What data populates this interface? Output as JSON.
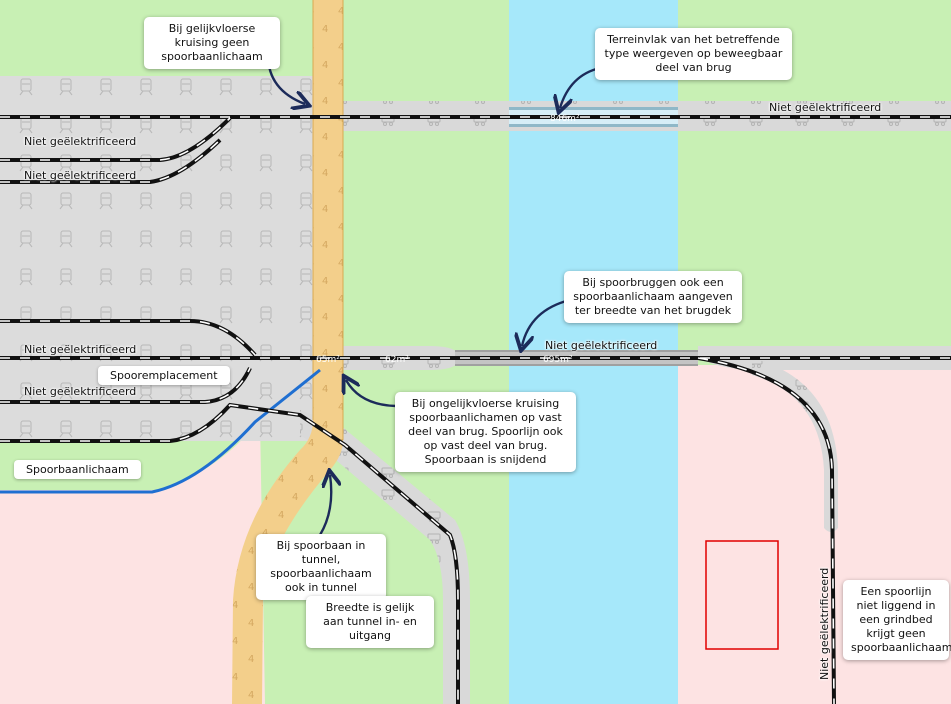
{
  "colors": {
    "grass": "#c8f0b4",
    "water": "#a6e8fa",
    "zone_pink": "#fde3e3",
    "yard_grey": "#dcdcdc",
    "trackbed_grey": "#d9d9d9",
    "road_orange": "#f3cf8b",
    "boundary_blue": "#1f6fd1",
    "marker_red": "#e10000",
    "arrow_navy": "#1c2b5a"
  },
  "icons": {
    "yard_pattern": "train-icon",
    "trackbed_pattern": "rail-wagon-icon",
    "road_pattern": "number-4-text"
  },
  "labels": {
    "niet_1": "Niet geëlektrificeerd",
    "niet_2": "Niet geëlektrificeerd",
    "niet_3": "Niet geëlektrificeerd",
    "niet_4": "Niet geëlektrificeerd",
    "niet_top_right": "Niet geëlektrificeerd",
    "niet_bridge": "Niet geëlektrificeerd",
    "niet_vertical": "Niet geëlektrificeerd",
    "spooremplacement": "Spooremplacement",
    "spoorbaanlichaam": "Spoorbaanlichaam"
  },
  "callouts": {
    "gelijkvloers": "Bij gelijkvloerse kruising geen spoorbaanlichaam",
    "terreinvlak": "Terreinvlak van het betreffende type weergeven op beweegbaar deel van brug",
    "spoorbruggen": "Bij spoorbruggen ook een spoorbaanlichaam aangeven ter breedte van het brugdek",
    "ongelijkvloers": "Bij ongelijkvloerse kruising spoorbaanlichamen op vast deel van brug. Spoorlijn ook op vast deel van brug. Spoorbaan is snijdend",
    "tunnel": "Bij spoorbaan in tunnel, spoorbaanlichaam ook in tunnel",
    "breedte": "Breedte is gelijk aan tunnel in- en uitgang",
    "grindbed": "Een spoorlijn niet liggend in een grindbed krijgt geen spoorbaanlichaam"
  },
  "map_text": {
    "area_top_bridge": "846m²",
    "area_bridge": "695m²",
    "area_road_bridge": "65m²",
    "area_mid": "62m²",
    "road_number": "4"
  }
}
